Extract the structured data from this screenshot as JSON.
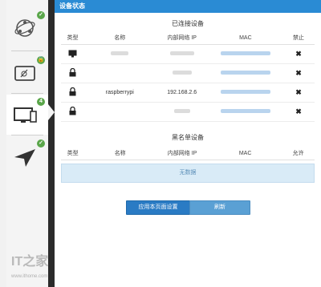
{
  "header": {
    "title": "设备状态"
  },
  "connected": {
    "title": "已连接设备",
    "columns": [
      "类型",
      "名称",
      "内部网络 IP",
      "MAC",
      "禁止"
    ],
    "rows": [
      {
        "type": "desktop",
        "name": "",
        "ip": "",
        "mac": "",
        "action": "✖"
      },
      {
        "type": "lock",
        "name": "",
        "ip": "",
        "mac": "",
        "action": "✖"
      },
      {
        "type": "lock",
        "name": "raspberrypi",
        "ip": "192.168.2.6",
        "mac": "",
        "action": "✖"
      },
      {
        "type": "lock",
        "name": "",
        "ip": "",
        "mac": "",
        "action": "✖"
      }
    ]
  },
  "blacklist": {
    "title": "黑名单设备",
    "columns": [
      "类型",
      "名称",
      "内部网络 IP",
      "MAC",
      "允许"
    ],
    "empty_text": "无数据"
  },
  "buttons": {
    "apply": "应用本页面设置",
    "refresh": "刷新"
  },
  "sidebar": {
    "items": [
      {
        "icon": "network-globe-icon",
        "badge": "✓"
      },
      {
        "icon": "tablet-icon",
        "badge": "🔒"
      },
      {
        "icon": "devices-icon",
        "badge": "4"
      },
      {
        "icon": "send-icon",
        "badge": "✓"
      }
    ]
  },
  "watermark": {
    "logo": "IT之家",
    "url": "www.ithome.com"
  },
  "colors": {
    "accent": "#2a8bd4",
    "badge": "#5aa64a",
    "nodata_bg": "#d9ebf7"
  }
}
